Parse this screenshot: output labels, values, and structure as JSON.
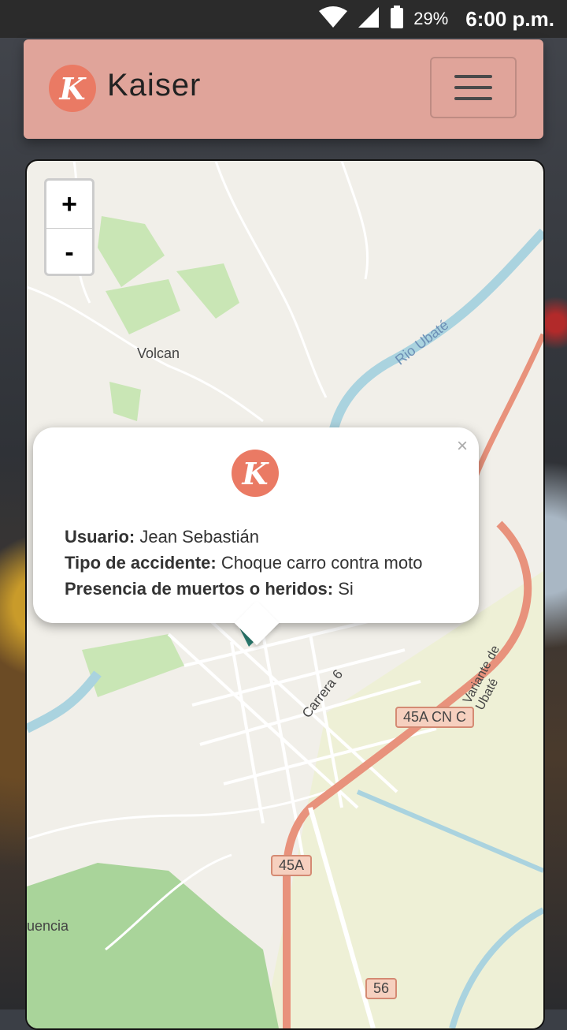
{
  "status_bar": {
    "battery": "29%",
    "battery_icon_text": "100",
    "time": "6:00 p.m."
  },
  "navbar": {
    "brand": "Kaiser",
    "logo_letter": "K",
    "menu_icon": "hamburger-icon"
  },
  "map": {
    "zoom_in": "+",
    "zoom_out": "-",
    "labels": {
      "volcan": "Volcan",
      "rio": "Rio Ubaté",
      "carrera": "Carrera 6",
      "variante": "Variante de Ubaté",
      "fuquene": "uencia"
    },
    "shields": {
      "a": "45A CN C",
      "b": "45A",
      "c": "56"
    }
  },
  "popup": {
    "close": "×",
    "logo_letter": "K",
    "user_label": "Usuario:",
    "user_value": " Jean Sebastián",
    "type_label": "Tipo de accidente:",
    "type_value": " Choque carro contra moto",
    "dead_label": "Presencia de muertos o heridos:",
    "dead_value": " Si"
  },
  "colors": {
    "brand": "#e0a49a",
    "logo": "#ea7a64",
    "marker": "#2a7a6e"
  }
}
